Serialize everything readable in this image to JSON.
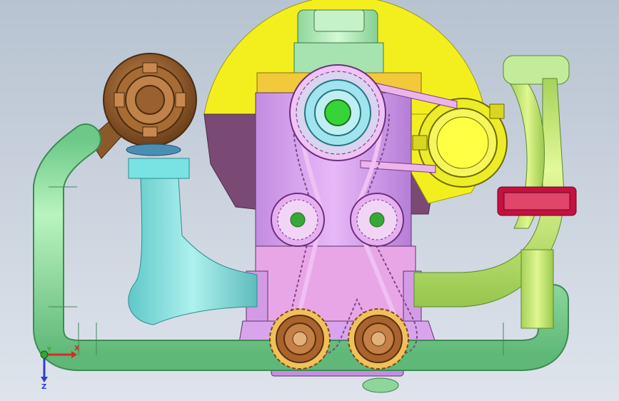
{
  "viewport": {
    "background_top": "#b7c3d1",
    "background_bottom": "#dfe4ec"
  },
  "model": {
    "components": [
      {
        "name": "turbocharger",
        "color": "#8b5a2b"
      },
      {
        "name": "intake-pipe",
        "color": "#9fe7a8"
      },
      {
        "name": "exhaust-manifold",
        "color": "#7ee0de"
      },
      {
        "name": "crankcase-upper",
        "color": "#f2ef1f"
      },
      {
        "name": "crankcase-lower",
        "color": "#7a4a74"
      },
      {
        "name": "cylinder-block",
        "color": "#c89ae6"
      },
      {
        "name": "oil-sump",
        "color": "#e9a6e6"
      },
      {
        "name": "camshaft-pulley",
        "color": "#37d437"
      },
      {
        "name": "idler-pulleys",
        "color": "#36a836"
      },
      {
        "name": "crankshaft-gears",
        "color": "#a8632e"
      },
      {
        "name": "alternator",
        "color": "#ecec28"
      },
      {
        "name": "coolant-pipe",
        "color": "#c4ea73"
      },
      {
        "name": "thermostat-housing",
        "color": "#c5113f"
      }
    ]
  },
  "triad": {
    "x_label": "X",
    "y_label": "Y",
    "z_label": "Z",
    "x_color": "#e0262a",
    "y_color": "#2fa92f",
    "z_color": "#2a40d0"
  }
}
